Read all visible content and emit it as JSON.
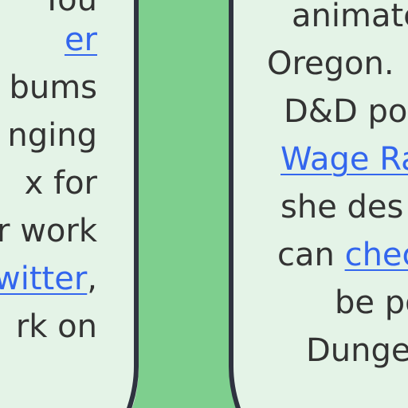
{
  "colors": {
    "page_background": "#e4f3e7",
    "divider_fill": "#7ecf8e",
    "divider_border": "#2f3340",
    "text": "#333333",
    "link": "#3366ee"
  },
  "left_column": {
    "lines": [
      {
        "text": "You"
      },
      {
        "link": "er "
      },
      {
        "text": "bums"
      },
      {
        "text": "nging"
      },
      {
        "text": "x for"
      },
      {
        "text": "r work"
      },
      {
        "link": "witter",
        "suffix": ","
      },
      {
        "text": "rk on"
      }
    ]
  },
  "right_column": {
    "lines": [
      {
        "text": "animate"
      },
      {
        "text": "Oregon."
      },
      {
        "text": "D&D po"
      },
      {
        "link": "Wage Ra"
      },
      {
        "text": "she des"
      },
      {
        "prefix": "can ",
        "link": "chec"
      },
      {
        "text": "be po"
      },
      {
        "text": "Dunge"
      }
    ]
  }
}
